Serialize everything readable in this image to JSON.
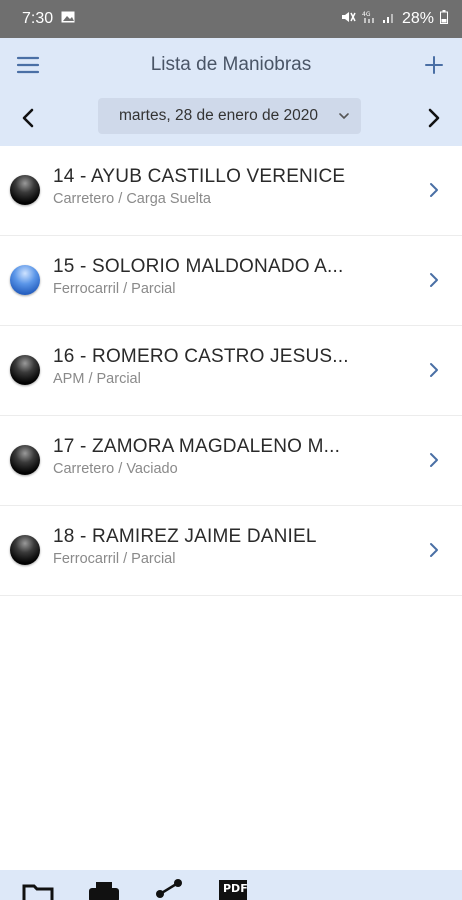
{
  "status_bar": {
    "time": "7:30",
    "battery": "28%"
  },
  "header": {
    "title": "Lista de Maniobras"
  },
  "date_selector": {
    "value": "martes, 28 de enero de 2020"
  },
  "items": [
    {
      "name": "14 - AYUB CASTILLO VERENICE",
      "detail": "Carretero / Carga Suelta",
      "status_color": "#000000"
    },
    {
      "name": "15 - SOLORIO MALDONADO A...",
      "detail": "Ferrocarril / Parcial",
      "status_color": "#3f7ee0"
    },
    {
      "name": "16 - ROMERO CASTRO JESUS...",
      "detail": "APM / Parcial",
      "status_color": "#000000"
    },
    {
      "name": "17 - ZAMORA MAGDALENO M...",
      "detail": "Carretero / Vaciado",
      "status_color": "#000000"
    },
    {
      "name": "18 - RAMIREZ JAIME DANIEL",
      "detail": "Ferrocarril / Parcial",
      "status_color": "#000000"
    }
  ],
  "toolbar": {
    "icons": [
      "folder-icon",
      "printer-icon",
      "share-icon",
      "pdf-icon"
    ],
    "pdf_label": "PDF"
  },
  "colors": {
    "header_bg": "#dde8f8",
    "accent": "#4a6fa5"
  }
}
